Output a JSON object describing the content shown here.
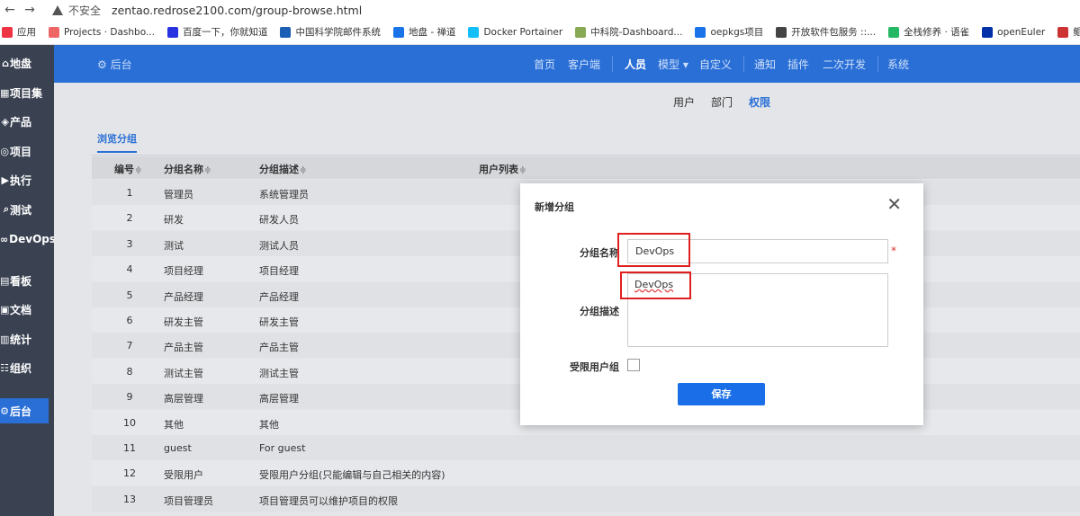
{
  "browser": {
    "back": "←",
    "forward": "→",
    "insecure_label": "不安全",
    "url": "zentao.redrose2100.com/group-browse.html"
  },
  "bookmarks": [
    {
      "label": "应用",
      "color": "#e34"
    },
    {
      "label": "Projects · Dashbo...",
      "color": "#e66"
    },
    {
      "label": "百度一下，你就知道",
      "color": "#2932e1"
    },
    {
      "label": "中国科学院邮件系统",
      "color": "#1a5fb4"
    },
    {
      "label": "地盘 - 禅道",
      "color": "#1a73e8"
    },
    {
      "label": "Docker Portainer",
      "color": "#13bef9"
    },
    {
      "label": "中科院-Dashboard...",
      "color": "#8a5"
    },
    {
      "label": "oepkgs项目",
      "color": "#1a73e8"
    },
    {
      "label": "开放软件包服务 ::...",
      "color": "#444"
    },
    {
      "label": "全栈修养 · 语雀",
      "color": "#25b864"
    },
    {
      "label": "openEuler",
      "color": "#002fa7"
    },
    {
      "label": "鲲鹏社区",
      "color": "#c33"
    }
  ],
  "sidebar": {
    "items": [
      {
        "icon": "⌂",
        "label": "地盘"
      },
      {
        "icon": "▦",
        "label": "项目集"
      },
      {
        "icon": "◈",
        "label": "产品"
      },
      {
        "icon": "◎",
        "label": "项目"
      },
      {
        "icon": "▶",
        "label": "执行"
      },
      {
        "icon": "⌕",
        "label": "测试"
      },
      {
        "icon": "∞",
        "label": "DevOps"
      },
      {
        "icon": "▤",
        "label": "看板"
      },
      {
        "icon": "▣",
        "label": "文档"
      },
      {
        "icon": "▥",
        "label": "统计"
      },
      {
        "icon": "☷",
        "label": "组织"
      },
      {
        "icon": "⚙",
        "label": "后台"
      }
    ]
  },
  "topnav": {
    "home": "⚙ 后台",
    "items": [
      "首页",
      "客户端",
      "人员",
      "模型 ▾",
      "自定义",
      "通知",
      "插件",
      "二次开发",
      "系统"
    ],
    "active": "人员"
  },
  "subnav": {
    "items": [
      "用户",
      "部门",
      "权限"
    ],
    "active": "权限"
  },
  "browse_tab": "浏览分组",
  "table": {
    "headers": [
      "编号",
      "分组名称",
      "分组描述",
      "用户列表"
    ],
    "sort_icon": "≑",
    "rows": [
      {
        "id": "1",
        "name": "管理员",
        "desc": "系统管理员"
      },
      {
        "id": "2",
        "name": "研发",
        "desc": "研发人员"
      },
      {
        "id": "3",
        "name": "测试",
        "desc": "测试人员"
      },
      {
        "id": "4",
        "name": "项目经理",
        "desc": "项目经理"
      },
      {
        "id": "5",
        "name": "产品经理",
        "desc": "产品经理"
      },
      {
        "id": "6",
        "name": "研发主管",
        "desc": "研发主管"
      },
      {
        "id": "7",
        "name": "产品主管",
        "desc": "产品主管"
      },
      {
        "id": "8",
        "name": "测试主管",
        "desc": "测试主管"
      },
      {
        "id": "9",
        "name": "高层管理",
        "desc": "高层管理"
      },
      {
        "id": "10",
        "name": "其他",
        "desc": "其他"
      },
      {
        "id": "11",
        "name": "guest",
        "desc": "For guest"
      },
      {
        "id": "12",
        "name": "受限用户",
        "desc": "受限用户分组(只能编辑与自己相关的内容)"
      },
      {
        "id": "13",
        "name": "项目管理员",
        "desc": "项目管理员可以维护项目的权限"
      }
    ]
  },
  "modal": {
    "title": "新增分组",
    "close": "✕",
    "name_label": "分组名称",
    "name_value": "DevOps",
    "required_mark": "*",
    "desc_label": "分组描述",
    "desc_value": "DevOps",
    "limited_label": "受限用户组",
    "save_label": "保存"
  }
}
